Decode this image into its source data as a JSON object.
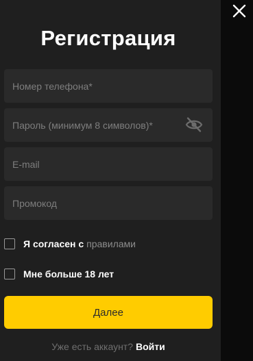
{
  "dialog": {
    "title": "Регистрация",
    "close_icon": "close-icon"
  },
  "form": {
    "phone": {
      "placeholder": "Номер телефона*",
      "value": ""
    },
    "password": {
      "placeholder": "Пароль (минимум 8 символов)*",
      "value": "",
      "toggle_icon": "eye-off-icon"
    },
    "email": {
      "placeholder": "E-mail",
      "value": ""
    },
    "promo": {
      "placeholder": "Промокод",
      "value": ""
    }
  },
  "checkboxes": {
    "terms": {
      "label": "Я согласен с",
      "link": "правилами",
      "checked": false
    },
    "age": {
      "label": "Мне больше 18 лет",
      "checked": false
    }
  },
  "submit_label": "Далее",
  "footer": {
    "question": "Уже есть аккаунт?",
    "login_link": "Войти"
  },
  "colors": {
    "accent": "#ffcc00",
    "background": "#1f1f1f",
    "field": "#2a2a2a"
  }
}
